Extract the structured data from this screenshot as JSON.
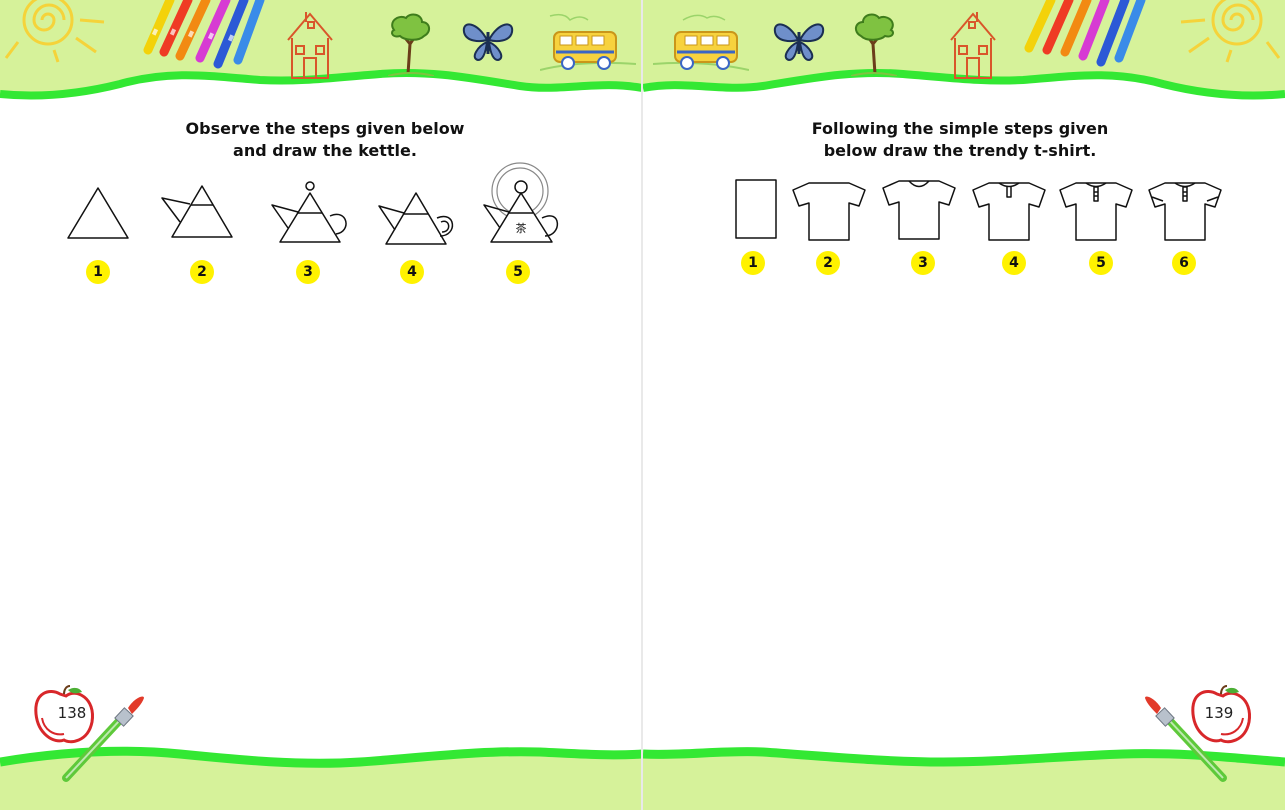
{
  "left_page": {
    "instruction_line1": "Observe the steps given below",
    "instruction_line2": "and draw the kettle.",
    "step_numbers": [
      "1",
      "2",
      "3",
      "4",
      "5"
    ],
    "kettle_label": "茶",
    "page_number": "138"
  },
  "right_page": {
    "instruction_line1": "Following the simple steps given",
    "instruction_line2": "below draw the trendy t-shirt.",
    "step_numbers": [
      "1",
      "2",
      "3",
      "4",
      "5",
      "6"
    ],
    "page_number": "139"
  },
  "colors": {
    "band_green": "#d6f29a",
    "wave_green": "#33e833",
    "badge_yellow": "#fff200"
  },
  "icons": [
    "sun-icon",
    "crayons-icon",
    "house-icon",
    "tree-icon",
    "butterfly-icon",
    "school-bus-icon",
    "apple-icon",
    "paintbrush-icon"
  ]
}
